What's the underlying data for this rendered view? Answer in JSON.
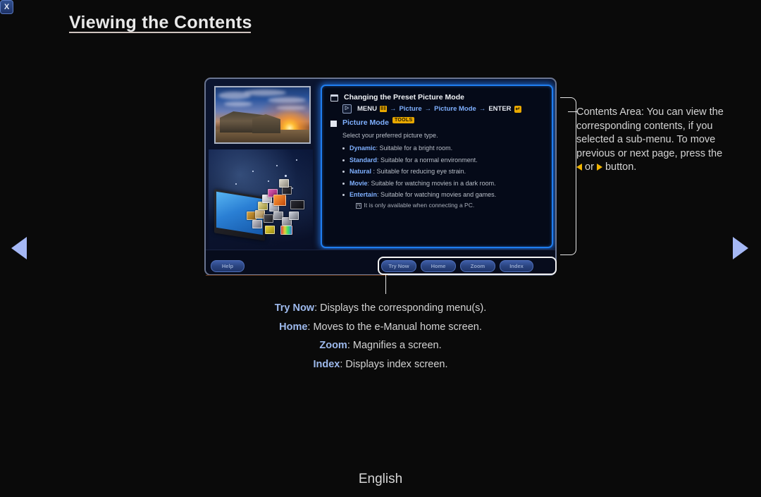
{
  "page": {
    "title": "Viewing the Contents",
    "footer_language": "English"
  },
  "nav": {
    "prev_label": "previous page",
    "next_label": "next page"
  },
  "emanual": {
    "contents": {
      "section_title": "Changing the Preset Picture Mode",
      "menu_path": {
        "menu": "MENU",
        "menu_badge": "‖‖",
        "arrow": "→",
        "step1": "Picture",
        "step2": "Picture Mode",
        "enter": "ENTER",
        "enter_badge": "↵"
      },
      "sub_title": "Picture Mode",
      "tools_badge": "TOOLS",
      "lead_text": "Select your preferred picture type.",
      "modes": [
        {
          "name": "Dynamic",
          "desc": ": Suitable for a bright room."
        },
        {
          "name": "Standard",
          "desc": ": Suitable for a normal environment."
        },
        {
          "name": "Natural",
          "desc": " : Suitable for reducing eye strain."
        },
        {
          "name": "Movie",
          "desc": ": Suitable for watching movies in a dark room."
        },
        {
          "name": "Entertain",
          "desc": ": Suitable for watching movies and games."
        }
      ],
      "note_marker": "N",
      "note": "It is only available when connecting a PC."
    },
    "buttons": {
      "help": "Help",
      "try_now": "Try Now",
      "home": "Home",
      "zoom": "Zoom",
      "index": "Index",
      "close": "X"
    }
  },
  "annotations": {
    "contents_area": {
      "part1": "Contents Area: You can view the corresponding contents, if you selected a sub-menu. To move previous or next page, press the ",
      "or": " or ",
      "part2": " button."
    }
  },
  "legend": [
    {
      "key": "Try Now",
      "text": ": Displays the corresponding menu(s)."
    },
    {
      "key": "Home",
      "text": ": Moves to the e-Manual home screen."
    },
    {
      "key": "Zoom",
      "text": ": Magnifies a screen."
    },
    {
      "key": "Index",
      "text": ": Displays index screen."
    }
  ],
  "colors": {
    "accent_blue": "#1f7ef0",
    "link_blue": "#7fb0ff",
    "badge_gold": "#e8a800",
    "arrow_blue": "#a5b8f5",
    "arrow_gold": "#f0b400"
  }
}
